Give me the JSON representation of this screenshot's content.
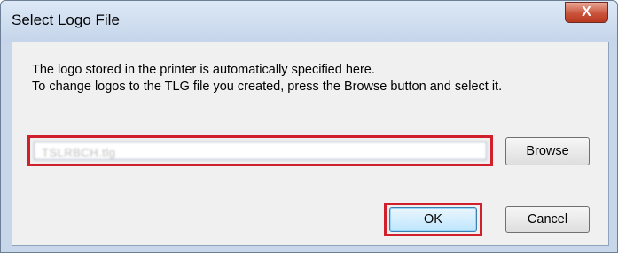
{
  "dialog": {
    "title": "Select Logo File",
    "close_label": "X",
    "message_line1": "The logo stored in the printer is automatically specified here.",
    "message_line2": "To change logos to the TLG file you created, press the Browse button and select it.",
    "file_path_value": "TSLRBCH.tlg",
    "browse_label": "Browse",
    "ok_label": "OK",
    "cancel_label": "Cancel"
  },
  "colors": {
    "highlight": "#d0202c",
    "close_button": "#c9543b"
  }
}
